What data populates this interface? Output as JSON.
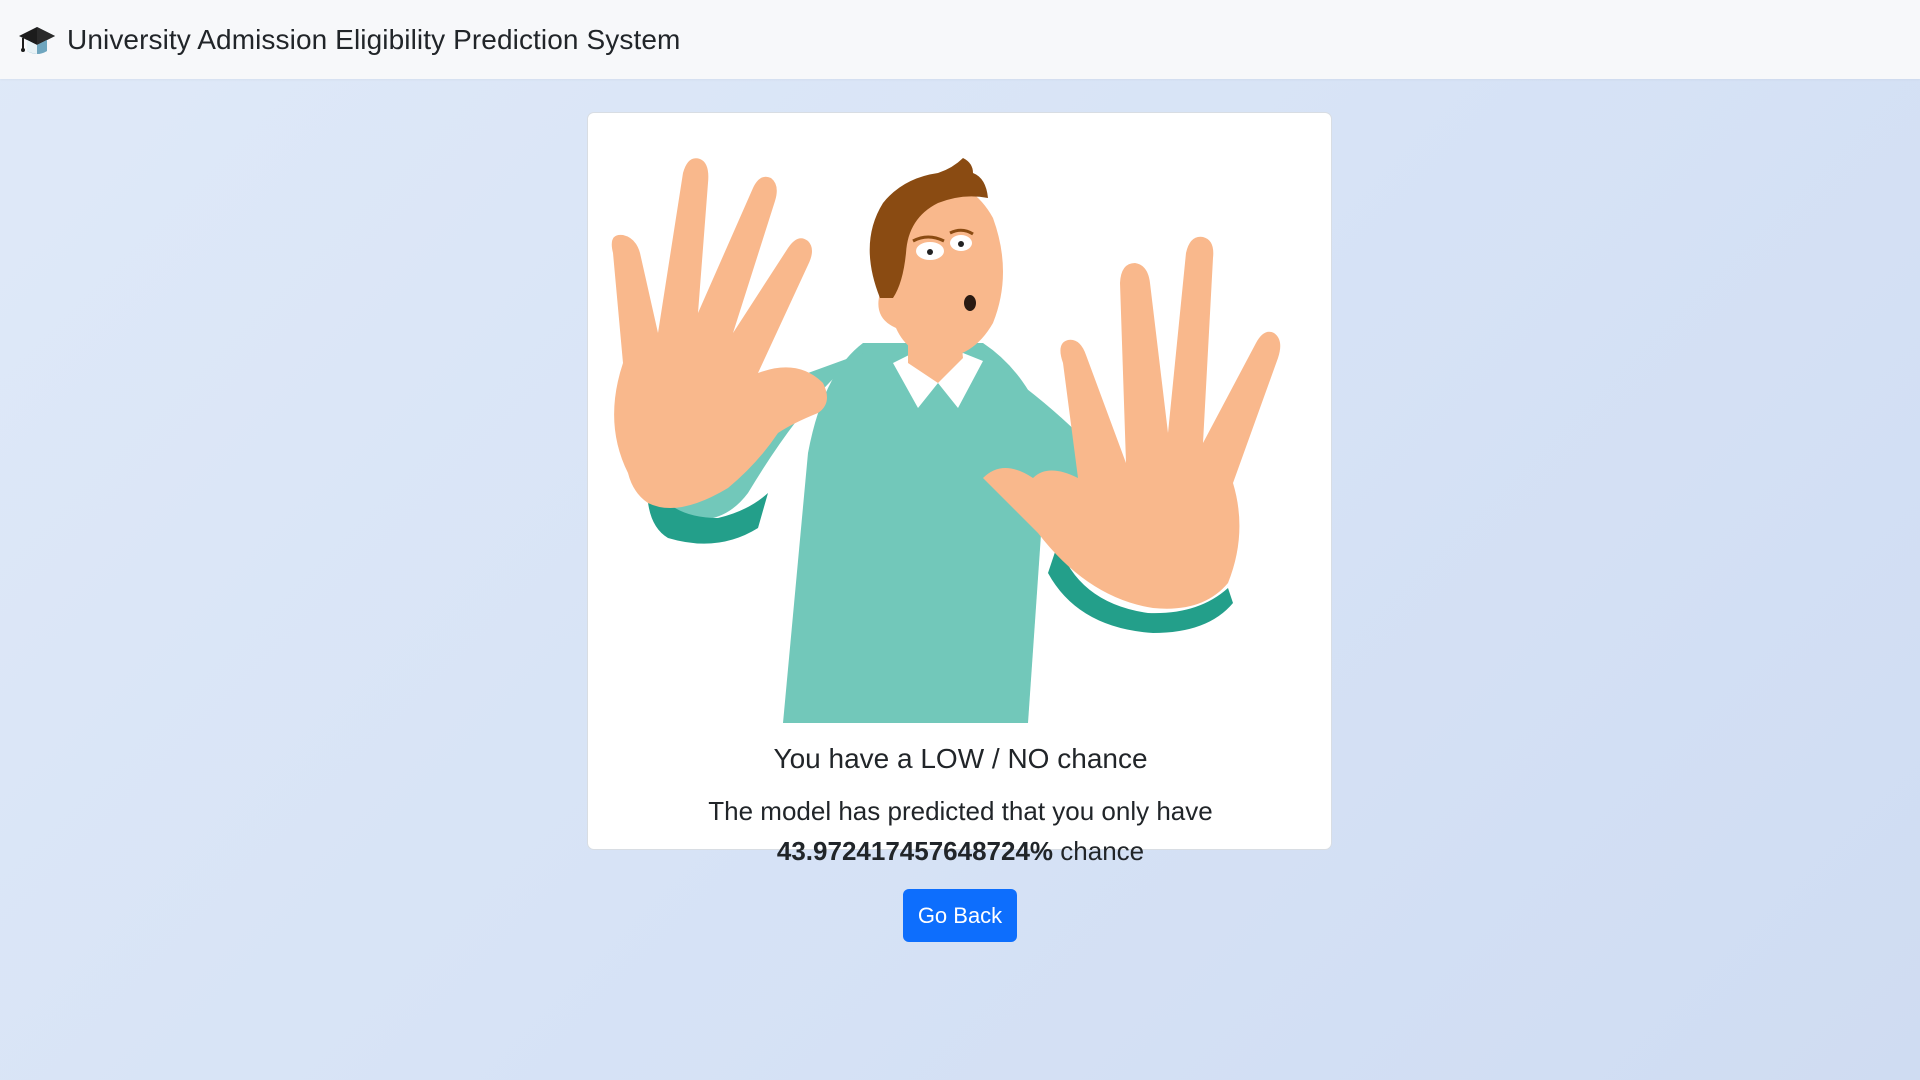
{
  "navbar": {
    "brand_icon": "graduation-cap-icon",
    "title": "University Admission Eligibility Prediction System"
  },
  "result": {
    "illustration": "man-with-raised-hands-illustration",
    "heading": "You have a LOW / NO chance",
    "message_prefix": "The model has predicted that you only have",
    "percentage": "43.972417457648724%",
    "message_suffix": "chance",
    "button_label": "Go Back"
  },
  "colors": {
    "primary_button": "#0d6efd",
    "navbar_bg": "#f7f8fa"
  }
}
